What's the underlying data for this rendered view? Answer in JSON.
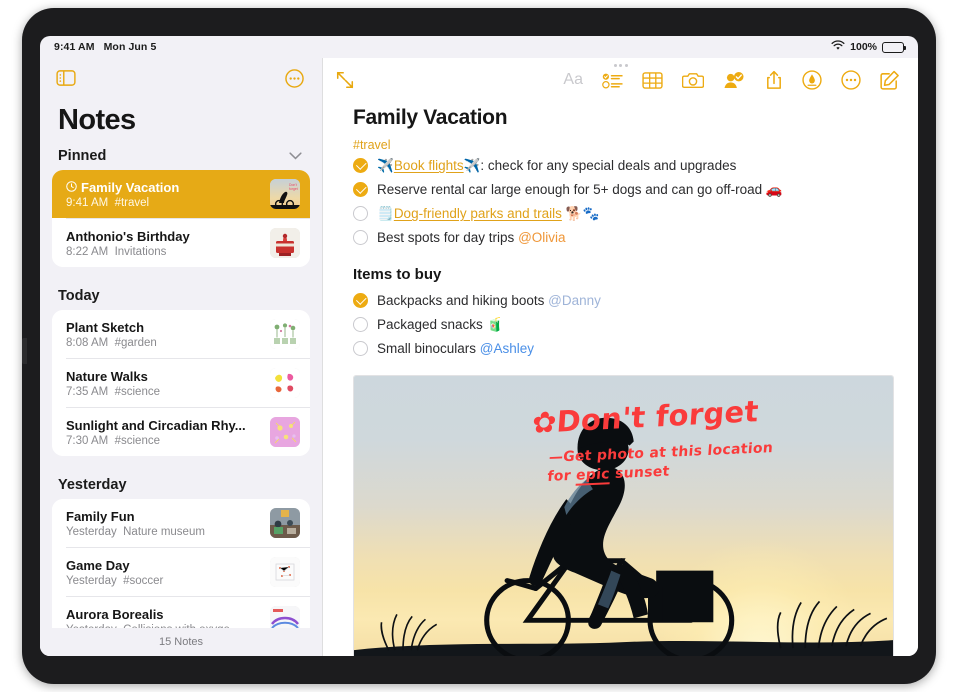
{
  "status_bar": {
    "time": "9:41 AM",
    "date": "Mon Jun 5",
    "battery_percent": "100%",
    "wifi_icon": "wifi-icon",
    "battery_icon": "battery-icon"
  },
  "sidebar": {
    "toggle_icon": "sidebar-toggle-icon",
    "more_icon": "more-circle-icon",
    "title": "Notes",
    "footer": "15 Notes",
    "sections": [
      {
        "label": "Pinned",
        "collapse_icon": "chevron-down-icon",
        "notes": [
          {
            "title": "Family Vacation",
            "time": "9:41 AM",
            "detail": "#travel",
            "selected": true,
            "locked_icon": "clock-icon",
            "thumb": "sunset-bike-thumb"
          },
          {
            "title": "Anthonio's Birthday",
            "time": "8:22 AM",
            "detail": "Invitations",
            "selected": false,
            "thumb": "birthday-cake-thumb"
          }
        ]
      },
      {
        "label": "Today",
        "notes": [
          {
            "title": "Plant Sketch",
            "time": "8:08 AM",
            "detail": "#garden",
            "selected": false,
            "thumb": "plant-sketch-thumb"
          },
          {
            "title": "Nature Walks",
            "time": "7:35 AM",
            "detail": "#science",
            "selected": false,
            "thumb": "nature-walk-thumb"
          },
          {
            "title": "Sunlight and Circadian Rhy...",
            "time": "7:30 AM",
            "detail": "#science",
            "selected": false,
            "thumb": "circadian-thumb"
          }
        ]
      },
      {
        "label": "Yesterday",
        "notes": [
          {
            "title": "Family Fun",
            "time": "Yesterday",
            "detail": "Nature museum",
            "selected": false,
            "thumb": "family-fun-thumb"
          },
          {
            "title": "Game Day",
            "time": "Yesterday",
            "detail": "#soccer",
            "selected": false,
            "thumb": "game-day-thumb"
          },
          {
            "title": "Aurora Borealis",
            "time": "Yesterday",
            "detail": "Collisions with oxyge",
            "selected": false,
            "thumb": "aurora-thumb"
          }
        ]
      }
    ]
  },
  "detail": {
    "expand_icon": "expand-arrows-icon",
    "drag_handle": "drag-handle-dots",
    "toolbar": [
      {
        "name": "format-text-icon",
        "label": "Aa",
        "disabled": true
      },
      {
        "name": "checklist-icon",
        "label": ""
      },
      {
        "name": "table-icon",
        "label": ""
      },
      {
        "name": "camera-icon",
        "label": ""
      },
      {
        "name": "collaborate-icon",
        "label": ""
      },
      {
        "name": "share-icon",
        "label": ""
      },
      {
        "name": "markup-pen-icon",
        "label": ""
      },
      {
        "name": "more-circle-icon",
        "label": ""
      },
      {
        "name": "compose-icon",
        "label": ""
      }
    ],
    "note_title": "Family Vacation",
    "note_tag": "#travel",
    "checklist": [
      {
        "checked": true,
        "emoji_prefix": "✈️",
        "link": "Book flights",
        "emoji_after_link": "✈️",
        "text": ": check for any special deals and upgrades"
      },
      {
        "checked": true,
        "text": "Reserve rental car large enough for 5+ dogs and can go off-road ",
        "emoji_suffix": "🚗"
      },
      {
        "checked": false,
        "emoji_prefix": "🗒️",
        "link": "Dog-friendly parks and trails",
        "emoji_suffix": " 🐕🐾"
      },
      {
        "checked": false,
        "text": "Best spots for day trips ",
        "mention": "@Olivia",
        "mention_style": "orange"
      }
    ],
    "sub_heading": "Items to buy",
    "buy_list": [
      {
        "checked": true,
        "text": "Backpacks and hiking boots ",
        "mention": "@Danny",
        "mention_style": "mute"
      },
      {
        "checked": false,
        "text": "Packaged snacks ",
        "emoji_suffix": "🧃"
      },
      {
        "checked": false,
        "text": "Small binoculars ",
        "mention": "@Ashley",
        "mention_style": "blue"
      }
    ],
    "photo": {
      "name": "cyclist-sunset-photo",
      "annotation_title": "✿Don't forget",
      "annotation_line1": "—Get photo at this location",
      "annotation_line2_pre": "for ",
      "annotation_line2_underline": "epic",
      "annotation_line2_post": " sunset",
      "scrollbar": "horizontal-scrollbar"
    }
  },
  "colors": {
    "accent_gold": "#e0a21a",
    "selected_row": "#e6aa16",
    "mention_blue": "#4a8fe7",
    "mention_orange": "#ef9637",
    "annotation_red": "#fa3b3b",
    "sidebar_bg": "#f2f1f6"
  }
}
